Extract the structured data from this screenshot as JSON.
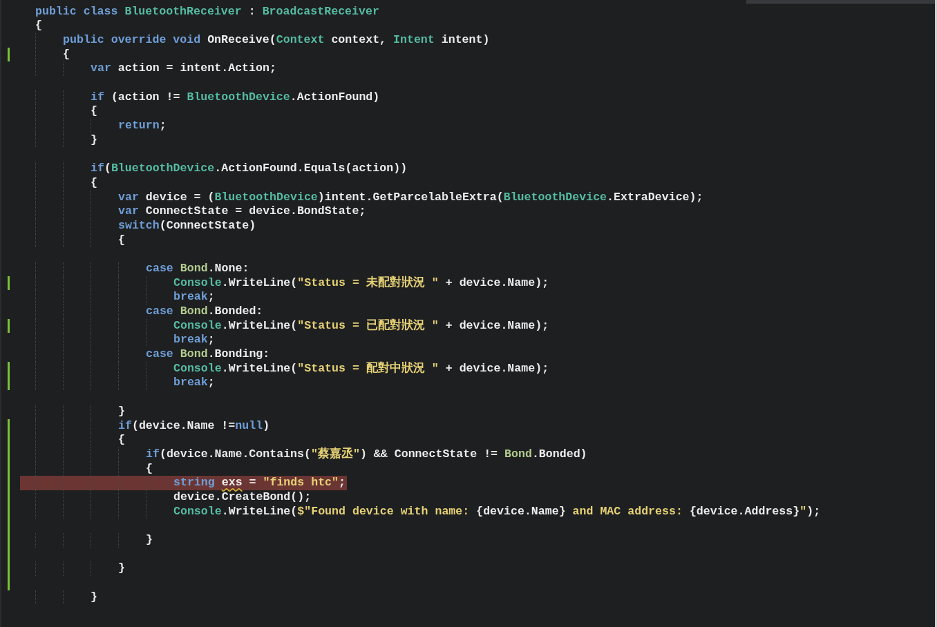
{
  "lines": [
    {
      "changed": false,
      "tokens": [
        {
          "kind": "kw",
          "text": "public class "
        },
        {
          "kind": "type",
          "text": "BluetoothReceiver"
        },
        {
          "kind": "plain",
          "text": " : "
        },
        {
          "kind": "type",
          "text": "BroadcastReceiver"
        }
      ]
    },
    {
      "changed": false,
      "tokens": [
        {
          "kind": "plain",
          "text": "{"
        }
      ]
    },
    {
      "changed": false,
      "tokens": [
        {
          "kind": "kw",
          "text": "    public override void "
        },
        {
          "kind": "plain",
          "text": "OnReceive("
        },
        {
          "kind": "type",
          "text": "Context"
        },
        {
          "kind": "plain",
          "text": " context, "
        },
        {
          "kind": "type",
          "text": "Intent"
        },
        {
          "kind": "plain",
          "text": " intent)"
        }
      ]
    },
    {
      "changed": true,
      "tokens": [
        {
          "kind": "plain",
          "text": "    {"
        }
      ]
    },
    {
      "changed": false,
      "tokens": [
        {
          "kind": "kw",
          "text": "        var "
        },
        {
          "kind": "plain",
          "text": "action = intent.Action;"
        }
      ]
    },
    {
      "changed": false
    },
    {
      "changed": false,
      "tokens": [
        {
          "kind": "kw",
          "text": "        if "
        },
        {
          "kind": "plain",
          "text": "(action != "
        },
        {
          "kind": "type",
          "text": "BluetoothDevice"
        },
        {
          "kind": "plain",
          "text": ".ActionFound)"
        }
      ]
    },
    {
      "changed": false,
      "tokens": [
        {
          "kind": "plain",
          "text": "        {"
        }
      ]
    },
    {
      "changed": false,
      "tokens": [
        {
          "kind": "kw",
          "text": "            return"
        },
        {
          "kind": "plain",
          "text": ";"
        }
      ]
    },
    {
      "changed": false,
      "tokens": [
        {
          "kind": "plain",
          "text": "        }"
        }
      ]
    },
    {
      "changed": false
    },
    {
      "changed": false,
      "tokens": [
        {
          "kind": "kw",
          "text": "        if"
        },
        {
          "kind": "plain",
          "text": "("
        },
        {
          "kind": "type",
          "text": "BluetoothDevice"
        },
        {
          "kind": "plain",
          "text": ".ActionFound.Equals(action))"
        }
      ]
    },
    {
      "changed": false,
      "tokens": [
        {
          "kind": "plain",
          "text": "        {"
        }
      ]
    },
    {
      "changed": false,
      "tokens": [
        {
          "kind": "kw",
          "text": "            var "
        },
        {
          "kind": "plain",
          "text": "device = ("
        },
        {
          "kind": "type",
          "text": "BluetoothDevice"
        },
        {
          "kind": "plain",
          "text": ")intent.GetParcelableExtra("
        },
        {
          "kind": "type",
          "text": "BluetoothDevice"
        },
        {
          "kind": "plain",
          "text": ".ExtraDevice);"
        }
      ]
    },
    {
      "changed": false,
      "tokens": [
        {
          "kind": "kw",
          "text": "            var "
        },
        {
          "kind": "plain",
          "text": "ConnectState = device.BondState;"
        }
      ]
    },
    {
      "changed": false,
      "tokens": [
        {
          "kind": "kw",
          "text": "            switch"
        },
        {
          "kind": "plain",
          "text": "(ConnectState)"
        }
      ]
    },
    {
      "changed": false,
      "tokens": [
        {
          "kind": "plain",
          "text": "            {"
        }
      ]
    },
    {
      "changed": false
    },
    {
      "changed": false,
      "tokens": [
        {
          "kind": "kw",
          "text": "                case "
        },
        {
          "kind": "enum",
          "text": "Bond"
        },
        {
          "kind": "plain",
          "text": ".None:"
        }
      ]
    },
    {
      "changed": true,
      "tokens": [
        {
          "kind": "type",
          "text": "                    Console"
        },
        {
          "kind": "plain",
          "text": ".WriteLine("
        },
        {
          "kind": "str",
          "text": "\"Status = 未配對狀況 \""
        },
        {
          "kind": "plain",
          "text": " + device.Name);"
        }
      ]
    },
    {
      "changed": false,
      "tokens": [
        {
          "kind": "kw",
          "text": "                    break"
        },
        {
          "kind": "plain",
          "text": ";"
        }
      ]
    },
    {
      "changed": false,
      "tokens": [
        {
          "kind": "kw",
          "text": "                case "
        },
        {
          "kind": "enum",
          "text": "Bond"
        },
        {
          "kind": "plain",
          "text": ".Bonded:"
        }
      ]
    },
    {
      "changed": true,
      "tokens": [
        {
          "kind": "type",
          "text": "                    Console"
        },
        {
          "kind": "plain",
          "text": ".WriteLine("
        },
        {
          "kind": "str",
          "text": "\"Status = 已配對狀況 \""
        },
        {
          "kind": "plain",
          "text": " + device.Name);"
        }
      ]
    },
    {
      "changed": false,
      "tokens": [
        {
          "kind": "kw",
          "text": "                    break"
        },
        {
          "kind": "plain",
          "text": ";"
        }
      ]
    },
    {
      "changed": false,
      "tokens": [
        {
          "kind": "kw",
          "text": "                case "
        },
        {
          "kind": "enum",
          "text": "Bond"
        },
        {
          "kind": "plain",
          "text": ".Bonding:"
        }
      ]
    },
    {
      "changed": true,
      "tokens": [
        {
          "kind": "type",
          "text": "                    Console"
        },
        {
          "kind": "plain",
          "text": ".WriteLine("
        },
        {
          "kind": "str",
          "text": "\"Status = 配對中狀況 \""
        },
        {
          "kind": "plain",
          "text": " + device.Name);"
        }
      ]
    },
    {
      "changed": true,
      "tokens": [
        {
          "kind": "kw",
          "text": "                    break"
        },
        {
          "kind": "plain",
          "text": ";"
        }
      ]
    },
    {
      "changed": false
    },
    {
      "changed": false,
      "tokens": [
        {
          "kind": "plain",
          "text": "            }"
        }
      ]
    },
    {
      "changed": true,
      "tokens": [
        {
          "kind": "kw",
          "text": "            if"
        },
        {
          "kind": "plain",
          "text": "(device.Name !="
        },
        {
          "kind": "kw",
          "text": "null"
        },
        {
          "kind": "plain",
          "text": ")"
        }
      ]
    },
    {
      "changed": true,
      "tokens": [
        {
          "kind": "plain",
          "text": "            {"
        }
      ]
    },
    {
      "changed": true,
      "tokens": [
        {
          "kind": "kw",
          "text": "                if"
        },
        {
          "kind": "plain",
          "text": "(device.Name.Contains("
        },
        {
          "kind": "str",
          "text": "\"蔡嘉丞\""
        },
        {
          "kind": "plain",
          "text": ") && ConnectState != "
        },
        {
          "kind": "enum",
          "text": "Bond"
        },
        {
          "kind": "plain",
          "text": ".Bonded)"
        }
      ]
    },
    {
      "changed": true,
      "tokens": [
        {
          "kind": "plain",
          "text": "                {"
        }
      ]
    },
    {
      "changed": true,
      "breakpoint": true,
      "tokens": [
        {
          "kind": "kw",
          "text": "                    string "
        },
        {
          "kind": "warn",
          "text": "exs"
        },
        {
          "kind": "plain",
          "text": " = "
        },
        {
          "kind": "str",
          "text": "\"finds htc\""
        },
        {
          "kind": "plain",
          "text": ";"
        }
      ]
    },
    {
      "changed": true,
      "tokens": [
        {
          "kind": "plain",
          "text": "                    device.CreateBond();"
        }
      ]
    },
    {
      "changed": true,
      "tokens": [
        {
          "kind": "type",
          "text": "                    Console"
        },
        {
          "kind": "plain",
          "text": ".WriteLine("
        },
        {
          "kind": "str",
          "text": "$\"Found device with name: "
        },
        {
          "kind": "plain",
          "text": "{device.Name}"
        },
        {
          "kind": "str",
          "text": " and MAC address: "
        },
        {
          "kind": "plain",
          "text": "{device.Address}"
        },
        {
          "kind": "str",
          "text": "\""
        },
        {
          "kind": "plain",
          "text": ");"
        }
      ]
    },
    {
      "changed": true
    },
    {
      "changed": true,
      "tokens": [
        {
          "kind": "plain",
          "text": "                }"
        }
      ]
    },
    {
      "changed": true
    },
    {
      "changed": true,
      "tokens": [
        {
          "kind": "plain",
          "text": "            }"
        }
      ]
    },
    {
      "changed": true
    },
    {
      "changed": false,
      "tokens": [
        {
          "kind": "plain",
          "text": "        }"
        }
      ]
    }
  ]
}
